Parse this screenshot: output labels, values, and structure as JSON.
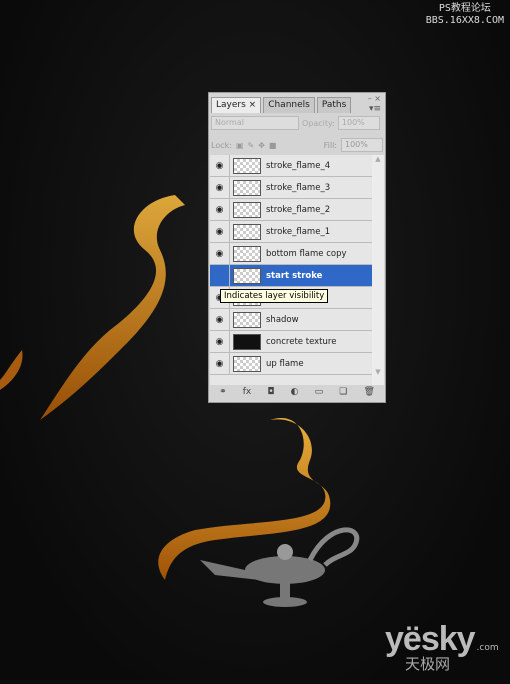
{
  "watermark": {
    "line1": "PS教程论坛",
    "line2": "BBS.16XX8.COM"
  },
  "logo": {
    "brand": "yësky",
    "suffix": ".com",
    "chinese": "天极网"
  },
  "panel": {
    "tabs": [
      {
        "label": "Layers ×",
        "active": true
      },
      {
        "label": "Channels"
      },
      {
        "label": "Paths"
      }
    ],
    "window_controls": "– ×",
    "menu_icon": "▾≡",
    "blend_mode": "Normal",
    "opacity_label": "Opacity:",
    "opacity_value": "100%",
    "lock_label": "Lock:",
    "fill_label": "Fill:",
    "fill_value": "100%",
    "layers": [
      {
        "name": "stroke_flame_4",
        "visible": true
      },
      {
        "name": "stroke_flame_3",
        "visible": true
      },
      {
        "name": "stroke_flame_2",
        "visible": true
      },
      {
        "name": "stroke_flame_1",
        "visible": true
      },
      {
        "name": "bottom flame copy",
        "visible": true
      },
      {
        "name": "start stroke",
        "visible": false,
        "selected": true
      },
      {
        "name": "",
        "visible": true
      },
      {
        "name": "shadow",
        "visible": true
      },
      {
        "name": "concrete texture",
        "visible": true,
        "dark_thumb": true
      },
      {
        "name": "up flame",
        "visible": true
      }
    ],
    "toolbar_icons": [
      "link-icon",
      "fx-icon",
      "mask-icon",
      "adjustment-icon",
      "folder-icon",
      "new-layer-icon",
      "trash-icon"
    ],
    "toolbar_glyphs": [
      "⚭",
      "fx",
      "◘",
      "◐",
      "▭",
      "❏",
      "🗑"
    ]
  },
  "tooltip": "Indicates layer visibility",
  "colors": {
    "selection": "#3068c8",
    "flame": "#f0a020"
  }
}
